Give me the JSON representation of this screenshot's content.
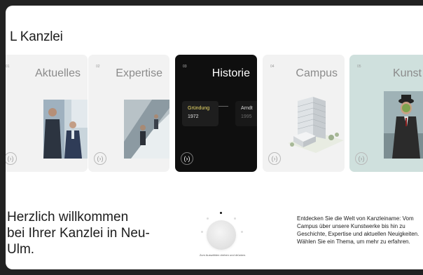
{
  "page": {
    "title": "L Kanzlei",
    "welcome": "Herzlich willkommen\nbei Ihrer Kanzlei in Neu-\nUlm."
  },
  "cards": [
    {
      "num": "01",
      "title": "Aktuelles",
      "arrow": "(›)"
    },
    {
      "num": "02",
      "title": "Expertise",
      "arrow": "(›)"
    },
    {
      "num": "03",
      "title": "Historie",
      "arrow": "(›)",
      "timeline": [
        {
          "label": "Gründung",
          "year": "1972"
        },
        {
          "label": "Arndt",
          "year": "1995"
        }
      ]
    },
    {
      "num": "04",
      "title": "Campus",
      "arrow": "(›)"
    },
    {
      "num": "05",
      "title": "Kunst",
      "arrow": "(›)"
    }
  ],
  "dial": {
    "hint": "Zum Auswählen drehen und drücken."
  },
  "intro": "Entdecken Sie die Welt von Kanzleiname: Vom Campus über unsere Kunstwerke bis hin zu Geschichte, Expertise und aktuellen Neuigkeiten. Wählen Sie ein Thema, um mehr zu erfahren.",
  "colors": {
    "card_light": "#f2f2f2",
    "card_active": "#0f0f0f",
    "card_kunst": "#cfe0dd",
    "timeline_highlight": "#f0df6a"
  }
}
